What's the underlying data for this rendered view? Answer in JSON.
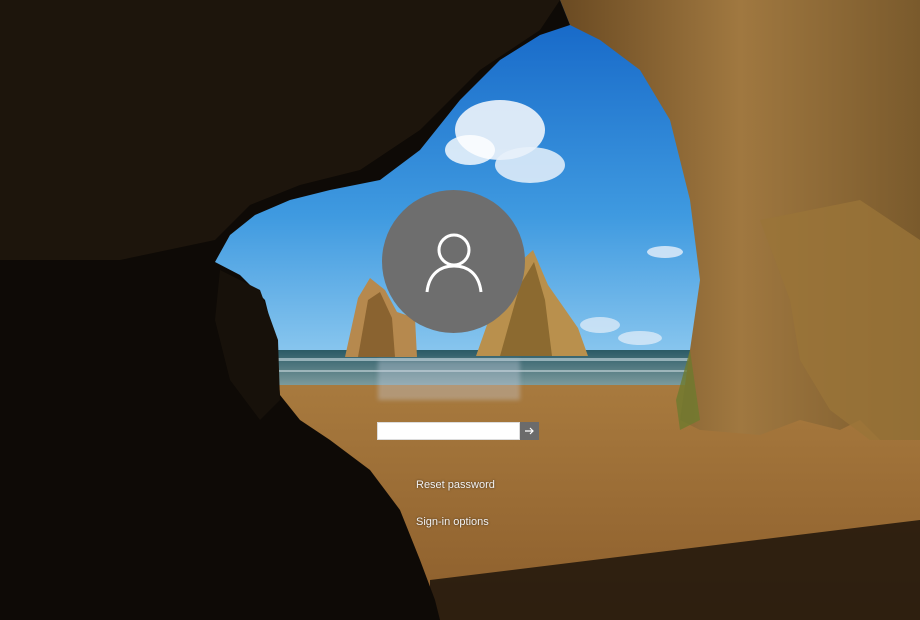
{
  "lock_screen": {
    "username": "",
    "password": {
      "value": "",
      "placeholder": ""
    },
    "submit_icon": "arrow-right-icon",
    "avatar_icon": "user-silhouette-icon",
    "reset_password_label": "Reset password",
    "sign_in_options_label": "Sign-in options"
  },
  "colors": {
    "avatar_bg": "#6e6e6e",
    "submit_bg": "#6b6b6b",
    "text": "#f2f2f2"
  }
}
